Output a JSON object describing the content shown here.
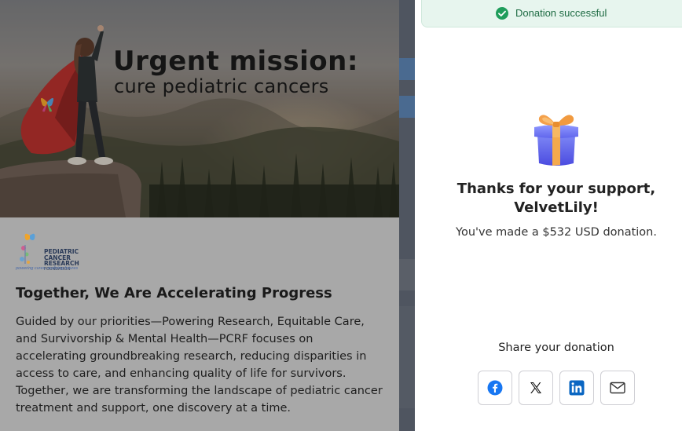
{
  "hero": {
    "headline_line1": "Urgent mission:",
    "headline_line2": "cure pediatric cancers"
  },
  "organization": {
    "logo_name": "PEDIATRIC CANCER RESEARCH",
    "logo_sub": "FOUNDATION",
    "logo_tagline": "powering cures, realizing futures"
  },
  "section": {
    "title": "Together, We Are Accelerating Progress",
    "body_lines": [
      "Guided by our priorities—Powering Research, Equitable Care,",
      "and Survivorship & Mental Health—PCRF focuses on",
      "accelerating groundbreaking research, reducing disparities in",
      "access to care, and enhancing quality of life for survivors.",
      "Together, we are transforming the landscape of pediatric cancer",
      "treatment and support, one discovery at a time."
    ]
  },
  "toast": {
    "icon": "check-circle-icon",
    "text": "Donation successful",
    "color": "#1e6b43"
  },
  "modal": {
    "gift_icon": "gift-icon",
    "thanks_line1": "Thanks for your support,",
    "thanks_line2": "VelvetLily!",
    "donation_message": "You've made a $532 USD donation.",
    "share_label": "Share your donation",
    "share_buttons": [
      {
        "name": "facebook",
        "icon": "facebook-icon",
        "color": "#1877f2"
      },
      {
        "name": "x",
        "icon": "x-icon",
        "color": "#111111"
      },
      {
        "name": "linkedin",
        "icon": "linkedin-icon",
        "color": "#0a66c2"
      },
      {
        "name": "email",
        "icon": "mail-icon",
        "color": "#333333"
      }
    ]
  }
}
